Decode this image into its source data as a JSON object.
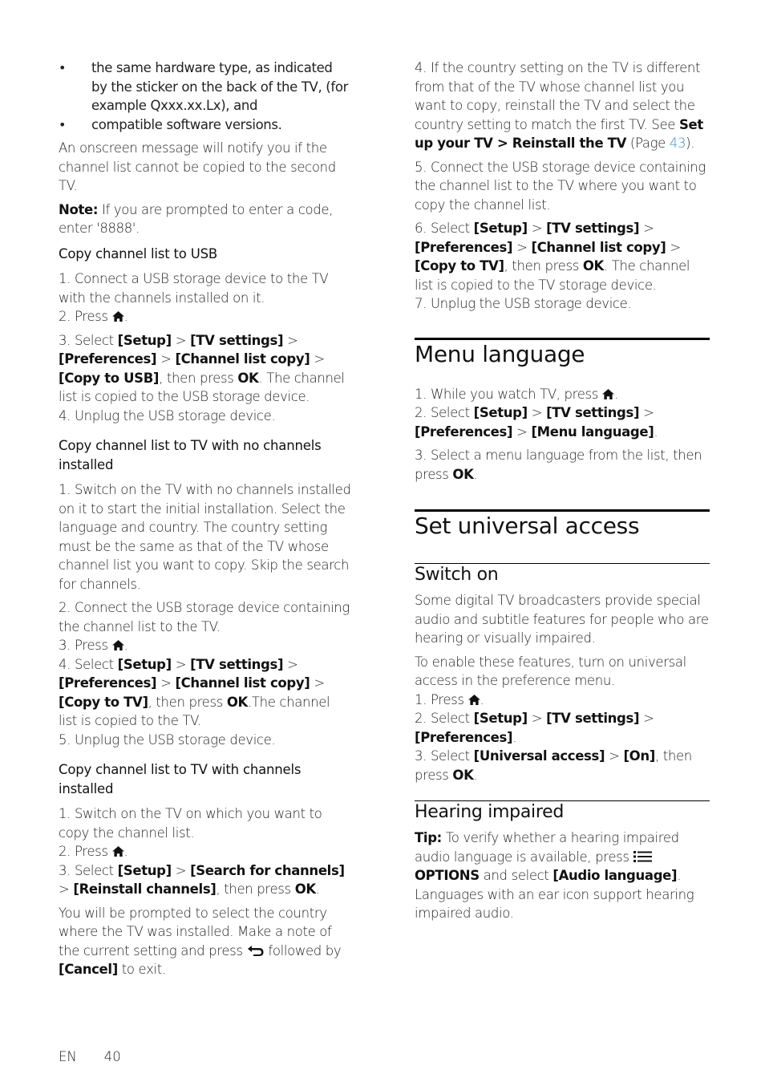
{
  "left_column": {
    "bullets": [
      "the same hardware type, as indicated by the sticker on the back of the TV, (for example Qxxx.xx.Lx), and",
      "compatible software versions."
    ],
    "onscreen_message": "An onscreen message will notify you if the channel list cannot be copied to the second TV.",
    "note": {
      "label": "Note:",
      "text": " If you are prompted to enter a code, enter '8888'."
    },
    "usb_section": {
      "heading": "Copy channel list to USB",
      "step1": "1. Connect a USB storage device to the TV with the channels installed on it.",
      "step2_prefix": "2. Press ",
      "step2_suffix": ".",
      "step3": {
        "prefix": "3. Select ",
        "setup": "[Setup]",
        "sep": " > ",
        "tv_settings": "[TV settings]",
        "preferences": "[Preferences]",
        "channel_list_copy": "[Channel list copy]",
        "copy_to_usb": "[Copy to USB]",
        "then_press": ", then press ",
        "ok": "OK",
        "rest": ". The channel list is copied to the USB storage device."
      },
      "step4": "4. Unplug the USB storage device."
    },
    "no_channels_section": {
      "heading": "Copy channel list to TV with no channels installed",
      "step1": "1. Switch on the TV with no channels installed on it to start the initial installation. Select the language and country. The country setting must be the same as that of the TV whose channel list you want to copy. Skip the search for channels.",
      "step2": "2. Connect the USB storage device containing the channel list to the TV.",
      "step3_prefix": "3. Press ",
      "step3_suffix": ".",
      "step4": {
        "prefix": "4. Select ",
        "setup": "[Setup]",
        "sep": " > ",
        "tv_settings": "[TV settings]",
        "preferences": "[Preferences]",
        "channel_list_copy": "[Channel list copy]",
        "copy_to_tv": "[Copy to TV]",
        "then_press": ", then press ",
        "ok": "OK",
        "rest": ".The channel list is copied to the TV."
      },
      "step5": "5. Unplug the USB storage device."
    },
    "with_channels_section": {
      "heading": "Copy channel list to TV with channels installed",
      "step1": "1. Switch on the TV on which you want to copy the channel list.",
      "step2_prefix": "2. Press ",
      "step2_suffix": ".",
      "step3": {
        "prefix": "3. Select ",
        "setup": "[Setup]",
        "sep": " > ",
        "search": "[Search for channels]",
        "reinstall": "[Reinstall channels]",
        "then_press": ", then press ",
        "ok": "OK",
        "rest": "."
      },
      "prompt": {
        "text": "You will be prompted to select the country where the TV was installed. Make a note of the current setting and press ",
        "followed_by": " followed by ",
        "cancel": "[Cancel]",
        "rest": " to exit."
      }
    }
  },
  "right_column": {
    "continued": {
      "step4_text": "4. If the country setting on the TV is different from that of the TV whose channel list you want to copy, reinstall the TV and select the country setting to match the first TV. See ",
      "step4_ref": "Set up your TV > Reinstall the TV",
      "step4_page_prefix": " (Page ",
      "step4_page": "43",
      "step4_page_suffix": ").",
      "step5": "5. Connect the USB storage device containing the channel list to the TV where you want to copy the channel list.",
      "step6": {
        "prefix": "6. Select ",
        "setup": "[Setup]",
        "sep": " > ",
        "tv_settings": "[TV settings]",
        "preferences": "[Preferences]",
        "channel_list_copy": "[Channel list copy]",
        "copy_to_tv": "[Copy to TV]",
        "then_press": ", then press ",
        "ok": "OK",
        "rest": ". The channel list is copied to the TV storage device."
      },
      "step7": "7. Unplug the USB storage device."
    },
    "menu_language": {
      "title": "Menu language",
      "step1_prefix": "1. While you watch TV, press ",
      "step1_suffix": ".",
      "step2": {
        "prefix": "2. Select ",
        "setup": "[Setup]",
        "sep": " > ",
        "tv_settings": "[TV settings]",
        "preferences": "[Preferences]",
        "menu_language": "[Menu language]",
        "rest": "."
      },
      "step3": {
        "text": "3. Select a menu language from the list, then press ",
        "ok": "OK",
        "rest": "."
      }
    },
    "universal_access": {
      "title": "Set universal access",
      "switch_on": {
        "heading": "Switch on",
        "para1": "Some digital TV broadcasters provide special audio and subtitle features for people who are hearing or visually impaired.",
        "para2": "To enable these features, turn on universal access in the preference menu.",
        "step1_prefix": "1. Press ",
        "step1_suffix": ".",
        "step2": {
          "prefix": "2. Select ",
          "setup": "[Setup]",
          "sep": " > ",
          "tv_settings": "[TV settings]",
          "preferences": "[Preferences]",
          "rest": "."
        },
        "step3": {
          "prefix": "3. Select ",
          "universal_access": "[Universal access]",
          "sep": " > ",
          "on": "[On]",
          "then_press": ", then press ",
          "ok": "OK",
          "rest": "."
        }
      },
      "hearing_impaired": {
        "heading": "Hearing impaired",
        "tip_label": "Tip:",
        "tip_text": " To verify whether a hearing impaired audio language is available, press ",
        "options": "OPTIONS",
        "and_select": " and select ",
        "audio_language": "[Audio language]",
        "rest": ".",
        "para2": "Languages with an ear icon support hearing impaired audio."
      }
    }
  },
  "footer": {
    "language": "EN",
    "page_number": "40"
  },
  "colors": {
    "link": "#3a8fc7",
    "text": "#222222"
  }
}
